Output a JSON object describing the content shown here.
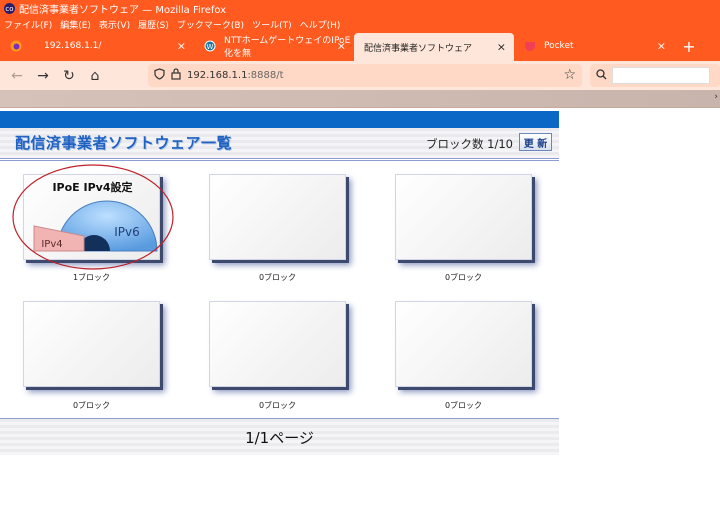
{
  "window": {
    "title": "配信済事業者ソフトウェア — Mozilla Firefox",
    "app_icon_text": "co"
  },
  "menu": [
    "ファイル(F)",
    "編集(E)",
    "表示(V)",
    "履歴(S)",
    "ブックマーク(B)",
    "ツール(T)",
    "ヘルプ(H)"
  ],
  "tabs": [
    {
      "label": "192.168.1.1/",
      "favicon": "firefox-icon"
    },
    {
      "label": "NTTホームゲートウェイのIPoE化を無",
      "favicon": "wordpress-icon"
    },
    {
      "label": "配信済事業者ソフトウェア",
      "favicon": "none",
      "active": true
    },
    {
      "label": "Pocket",
      "favicon": "pocket-icon"
    }
  ],
  "nav": {
    "url_host": "192.168.1.1",
    "url_path": ":8888/t"
  },
  "page": {
    "title": "配信済事業者ソフトウェア一覧",
    "block_count": "ブロック数 1/10",
    "refresh_label": "更 新",
    "cards": [
      {
        "title": "IPoE IPv4設定",
        "ipv6_label": "IPv6",
        "ipv4_label": "IPv4",
        "caption": "1ブロック"
      },
      {
        "caption": "0ブロック"
      },
      {
        "caption": "0ブロック"
      },
      {
        "caption": "0ブロック"
      },
      {
        "caption": "0ブロック"
      },
      {
        "caption": "0ブロック"
      }
    ],
    "pagination": "1/1ページ"
  },
  "colors": {
    "firefox_orange": "#ff5a1f",
    "brand_blue": "#0a67c6",
    "highlight_circle": "#c0202a"
  }
}
